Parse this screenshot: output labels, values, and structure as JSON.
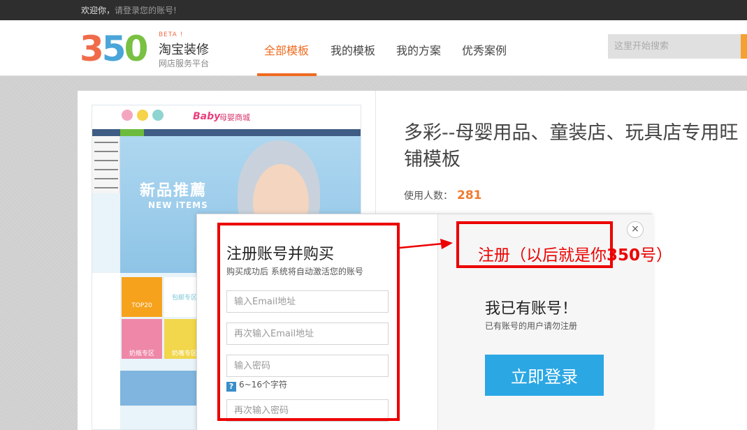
{
  "topbar": {
    "welcome": "欢迎你，",
    "login_prompt": "请登录您的账号!"
  },
  "logo": {
    "digits": [
      "3",
      "5",
      "0"
    ],
    "beta": "BETA !",
    "name": "淘宝装修",
    "subtitle": "网店服务平台"
  },
  "nav": {
    "items": [
      {
        "label": "全部模板",
        "active": true
      },
      {
        "label": "我的模板",
        "active": false
      },
      {
        "label": "我的方案",
        "active": false
      },
      {
        "label": "优秀案例",
        "active": false
      }
    ]
  },
  "search": {
    "placeholder": "这里开始搜索"
  },
  "preview": {
    "brand": "Baby",
    "brand_cn": "母婴商城",
    "hero_text": "新品推薦",
    "hero_sub": "NEW iTEMS",
    "tiles": [
      {
        "label": "TOP20",
        "color": "#f6a21d"
      },
      {
        "label": "包邮专区",
        "color": "#ffffff"
      },
      {
        "label": "奶瓶专区",
        "color": "#ef88a8"
      },
      {
        "label": "奶嘴专区",
        "color": "#f2d64b"
      }
    ]
  },
  "product": {
    "title": "多彩--母婴用品、童装店、玩具店专用旺铺模板",
    "usage_label": "使用人数：",
    "usage_count": "281"
  },
  "modal": {
    "register": {
      "title": "注册账号并购买",
      "subtitle": "购买成功后 系统将自动激活您的账号",
      "email_placeholder": "输入Email地址",
      "email_confirm_placeholder": "再次输入Email地址",
      "password_placeholder": "输入密码",
      "password_hint": "6~16个字符",
      "password_confirm_placeholder": "再次输入密码"
    },
    "login": {
      "title": "我已有账号！",
      "subtitle": "已有账号的用户请勿注册",
      "button": "立即登录"
    },
    "close": "×"
  },
  "annotation": {
    "text_prefix": "注册（以后就是你",
    "text_bold": "350",
    "text_suffix": "号）",
    "color": "#ec0000"
  }
}
